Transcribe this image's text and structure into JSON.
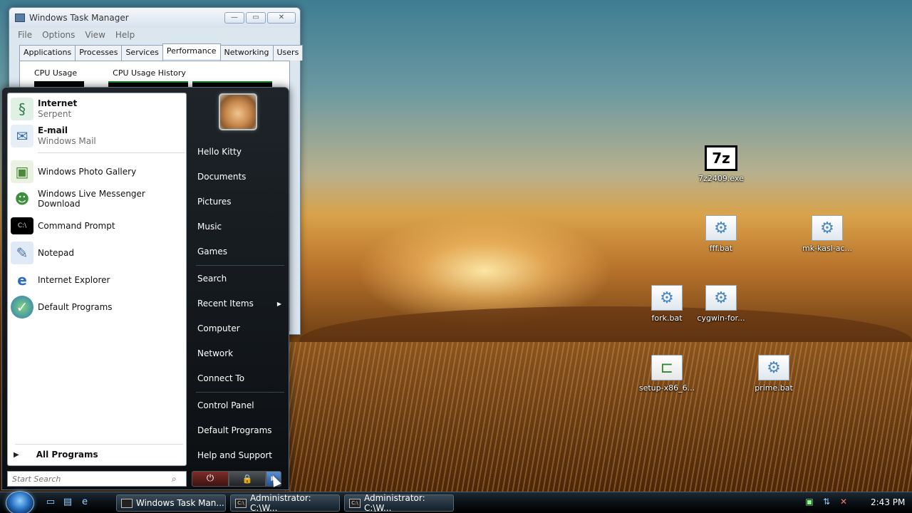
{
  "task_manager": {
    "title": "Windows Task Manager",
    "menu": [
      "File",
      "Options",
      "View",
      "Help"
    ],
    "tabs": [
      "Applications",
      "Processes",
      "Services",
      "Performance",
      "Networking",
      "Users"
    ],
    "active_tab": "Performance",
    "cpu_usage_label": "CPU Usage",
    "cpu_history_label": "CPU Usage History",
    "window_buttons": {
      "minimize": "—",
      "maximize": "▭",
      "close": "✕"
    }
  },
  "start_menu": {
    "pinned": [
      {
        "name": "Internet",
        "sub": "Serpent",
        "icon": "serpent-icon"
      },
      {
        "name": "E-mail",
        "sub": "Windows Mail",
        "icon": "mail-icon"
      }
    ],
    "recent": [
      {
        "name": "Windows Photo Gallery",
        "icon": "photo-gallery-icon"
      },
      {
        "name": "Windows Live Messenger Download",
        "icon": "messenger-icon"
      },
      {
        "name": "Command Prompt",
        "icon": "cmd-icon"
      },
      {
        "name": "Notepad",
        "icon": "notepad-icon"
      },
      {
        "name": "Internet Explorer",
        "icon": "ie-icon"
      },
      {
        "name": "Default Programs",
        "icon": "default-programs-icon"
      }
    ],
    "all_programs": "All Programs",
    "search_placeholder": "Start Search",
    "right_items": [
      "Hello Kitty",
      "Documents",
      "Pictures",
      "Music",
      "Games",
      "Search",
      "Recent Items",
      "Computer",
      "Network",
      "Connect To",
      "Control Panel",
      "Default Programs",
      "Help and Support"
    ],
    "power_glyph": "⏻",
    "lock_glyph": "🔒",
    "arrow_glyph": "▶"
  },
  "desktop_icons": [
    {
      "label": "7z2409.exe",
      "icon": "7zip-icon",
      "glyph": "7z"
    },
    {
      "label": "fff.bat",
      "icon": "batch-file-icon",
      "glyph": "⚙"
    },
    {
      "label": "mk-kasl-ac...",
      "icon": "batch-file-icon",
      "glyph": "⚙"
    },
    {
      "label": "fork.bat",
      "icon": "batch-file-icon",
      "glyph": "⚙"
    },
    {
      "label": "cygwin-for...",
      "icon": "batch-file-icon",
      "glyph": "⚙"
    },
    {
      "label": "setup-x86_6...",
      "icon": "setup-icon",
      "glyph": "⊏"
    },
    {
      "label": "prime.bat",
      "icon": "batch-file-icon",
      "glyph": "⚙"
    }
  ],
  "taskbar": {
    "buttons": [
      "Windows Task Man...",
      "Administrator: C:\\W...",
      "Administrator: C:\\W..."
    ],
    "clock": "2:43 PM"
  },
  "colors": {
    "accent": "#2a72c2",
    "menu_bg": "#0c0f12",
    "power_red": "#7e2d2b"
  }
}
